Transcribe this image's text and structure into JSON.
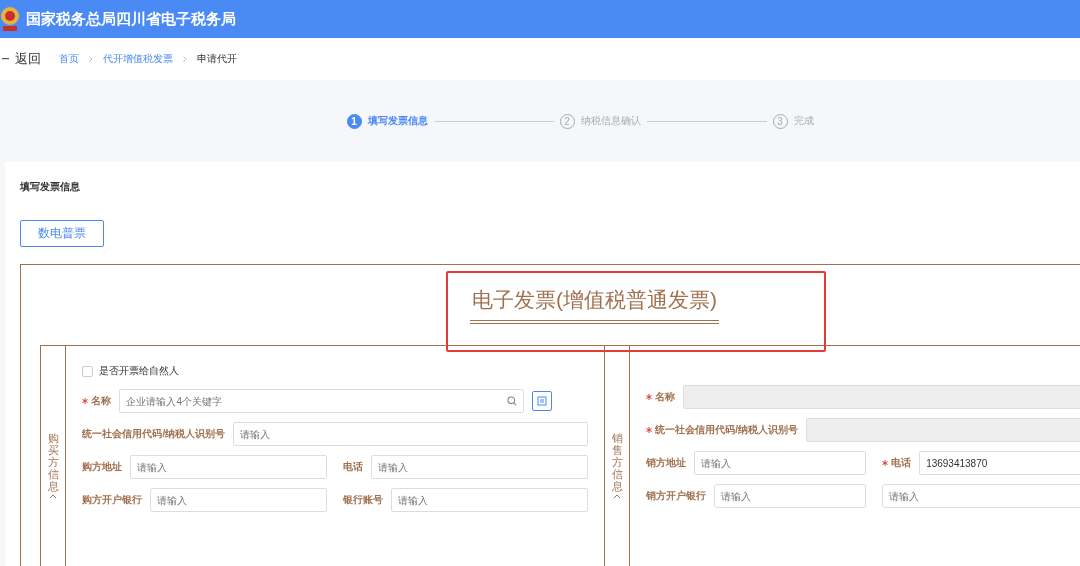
{
  "header": {
    "title": "国家税务总局四川省电子税务局"
  },
  "breadcrumb": {
    "back": "返回",
    "items": [
      {
        "label": "首页",
        "current": false
      },
      {
        "label": "代开增值税发票",
        "current": false
      },
      {
        "label": "申请代开",
        "current": true
      }
    ]
  },
  "steps": [
    {
      "number": "1",
      "label": "填写发票信息",
      "selected": true
    },
    {
      "number": "2",
      "label": "纳税信息确认",
      "selected": false
    },
    {
      "number": "3",
      "label": "完成",
      "selected": false
    }
  ],
  "section_title": "填写发票信息",
  "invoice_types": [
    {
      "label": "数电普票",
      "selected": true
    }
  ],
  "invoice": {
    "title": "电子发票(增值税普通发票)",
    "buyer": {
      "side_label": "购买方信息",
      "natural_person": {
        "label": "是否开票给自然人",
        "checked": false
      },
      "rows": [
        [
          {
            "kind": "search",
            "label": "名称",
            "required": true,
            "placeholder": "企业请输入4个关键字",
            "disabled": false
          }
        ],
        [
          {
            "kind": "text",
            "label": "统一社会信用代码/纳税人识别号",
            "required": false,
            "placeholder": "请输入",
            "disabled": false
          }
        ],
        [
          {
            "kind": "text",
            "label": "购方地址",
            "required": false,
            "placeholder": "请输入",
            "disabled": false
          },
          {
            "kind": "text",
            "label": "电话",
            "required": false,
            "placeholder": "请输入",
            "disabled": false
          }
        ],
        [
          {
            "kind": "text",
            "label": "购方开户银行",
            "required": false,
            "placeholder": "请输入",
            "disabled": false
          },
          {
            "kind": "text",
            "label": "银行账号",
            "required": false,
            "placeholder": "请输入",
            "disabled": false
          }
        ]
      ]
    },
    "seller": {
      "side_label": "销售方信息",
      "rows": [
        [
          {
            "kind": "text",
            "label": "名称",
            "required": true,
            "disabled": true
          }
        ],
        [
          {
            "kind": "text",
            "label": "统一社会信用代码/纳税人识别号",
            "required": true,
            "disabled": true
          }
        ],
        [
          {
            "kind": "text",
            "label": "销方地址",
            "required": false,
            "placeholder": "请输入",
            "disabled": false
          },
          {
            "kind": "text",
            "label": "电话",
            "required": true,
            "value": "13693413870",
            "disabled": false
          }
        ],
        [
          {
            "kind": "text",
            "label": "销方开户银行",
            "required": false,
            "placeholder": "请输入",
            "disabled": false
          },
          {
            "kind": "text",
            "required": false,
            "placeholder": "请输入",
            "disabled": false
          }
        ]
      ]
    }
  }
}
